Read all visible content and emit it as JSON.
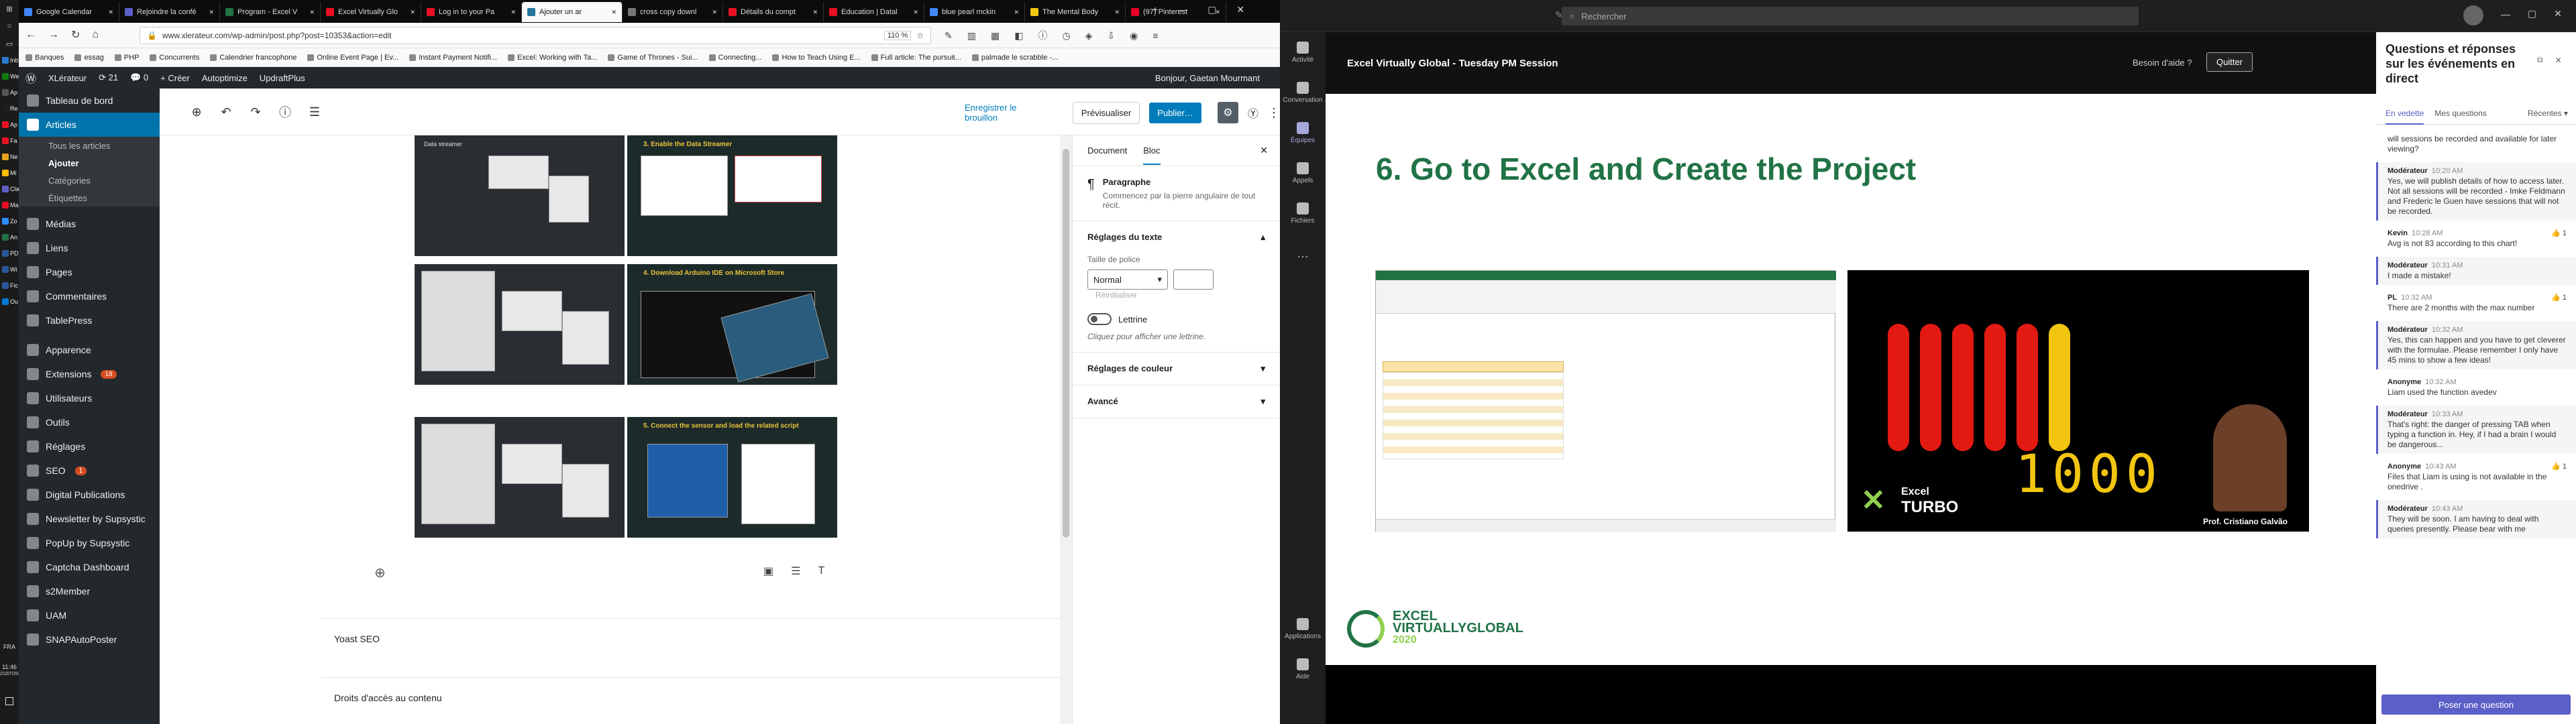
{
  "taskbar": {
    "apps": [
      {
        "label": "Inb",
        "color": "#2b7cd3"
      },
      {
        "label": "We",
        "color": "#107c10"
      },
      {
        "label": "Ap",
        "color": "#555555"
      },
      {
        "label": "Re",
        "color": "#1e1e1e"
      },
      {
        "label": "Ap",
        "color": "#e81123"
      },
      {
        "label": "Fa",
        "color": "#e81123"
      },
      {
        "label": "Ne",
        "color": "#e3a21a"
      },
      {
        "label": "Mi",
        "color": "#ffb900"
      },
      {
        "label": "Cla",
        "color": "#5b5fc7"
      },
      {
        "label": "Ma",
        "color": "#e81123"
      },
      {
        "label": "Zo",
        "color": "#2d8cff"
      },
      {
        "label": "An",
        "color": "#217346"
      },
      {
        "label": "PD",
        "color": "#2b579a"
      },
      {
        "label": "Wi",
        "color": "#2b579a"
      },
      {
        "label": "Fic",
        "color": "#2b579a"
      },
      {
        "label": "Ou",
        "color": "#0078d4"
      }
    ],
    "lang": "FRA",
    "time": "11:46",
    "date": "21/07/2020"
  },
  "firefox": {
    "tabs": [
      {
        "label": "Google Calendar",
        "color": "#4285f4"
      },
      {
        "label": "Rejoindre la confé",
        "color": "#5b5fc7"
      },
      {
        "label": "Program - Excel V",
        "color": "#217346"
      },
      {
        "label": "Excel Virtually Glo",
        "color": "#e81123"
      },
      {
        "label": "Log in to your Pa",
        "color": "#e81123"
      },
      {
        "label": "Ajouter un ar",
        "color": "#21759b",
        "active": true
      },
      {
        "label": "cross copy downl",
        "color": "#777777"
      },
      {
        "label": "Détails du compt",
        "color": "#e81123"
      },
      {
        "label": "Education | Datal",
        "color": "#e81123"
      },
      {
        "label": "blue pearl mckin",
        "color": "#4285f4"
      },
      {
        "label": "The Mental Body",
        "color": "#f2c811"
      },
      {
        "label": "(97) Pinterest",
        "color": "#e60023"
      }
    ],
    "url": "www.xlerateur.com/wp-admin/post.php?post=10353&action=edit",
    "zoom": "110 %",
    "bookmarks": [
      "Banques",
      "essag",
      "PHP",
      "Concurrents",
      "Calendrier francophone",
      "Online Event Page | Ev...",
      "Instant Payment Notifi...",
      "Excel: Working with Ta...",
      "Game of Thrones - Sui...",
      "Connecting...",
      "How to Teach Using E...",
      "Full article: The pursuit...",
      "palmade le scrabble -..."
    ]
  },
  "wpbar": {
    "site": "XLérateur",
    "updates": "21",
    "comments": "0",
    "new": "Créer",
    "autoptimize": "Autoptimize",
    "updraft": "UpdraftPlus",
    "greeting": "Bonjour, Gaetan Mourmant"
  },
  "wpmenu": {
    "dashboard": "Tableau de bord",
    "articles": "Articles",
    "sub": [
      "Tous les articles",
      "Ajouter",
      "Catégories",
      "Étiquettes"
    ],
    "items": [
      "Médias",
      "Liens",
      "Pages",
      "Commentaires",
      "TablePress",
      "Apparence",
      "Extensions",
      "Utilisateurs",
      "Outils",
      "Réglages",
      "SEO",
      "Digital Publications",
      "Newsletter by Supsystic",
      "PopUp by Supsystic",
      "Captcha Dashboard",
      "s2Member",
      "UAM",
      "SNAPAutoPoster"
    ],
    "extensions_badge": "18",
    "seo_badge": "1"
  },
  "editor": {
    "save_draft": "Enregistrer le brouillon",
    "preview": "Prévisualiser",
    "publish": "Publier…",
    "thumbs": [
      {
        "left_label": "Data streamer",
        "right_label": "3. Enable the Data Streamer"
      },
      {
        "left_label": "",
        "right_label": "4. Download Arduino IDE on Microsoft Store"
      },
      {
        "left_label": "",
        "right_label": "5. Connect the sensor and load the related script"
      }
    ],
    "panels": [
      "Yoast SEO",
      "Droits d'accès au contenu"
    ]
  },
  "inspector": {
    "tab_doc": "Document",
    "tab_block": "Bloc",
    "block_name": "Paragraphe",
    "block_desc": "Commencez par la pierre angulaire de tout récit.",
    "text_settings": "Réglages du texte",
    "font_size_label": "Taille de police",
    "font_size_value": "Normal",
    "reset": "Réinitialiser",
    "dropcap": "Lettrine",
    "dropcap_hint": "Cliquez pour afficher une lettrine.",
    "color_settings": "Réglages de couleur",
    "advanced": "Avancé"
  },
  "teams": {
    "search": "Rechercher",
    "rail": [
      "Activité",
      "Conversation",
      "Équipes",
      "Appels",
      "Fichiers",
      "…",
      "Applications",
      "Aide"
    ],
    "meeting_title": "Excel Virtually Global - Tuesday PM Session",
    "help": "Besoin d'aide ?",
    "leave": "Quitter",
    "slide_title": "6. Go to Excel and Create the Project",
    "counter": "1000",
    "logo_excel": "Excel",
    "logo_turbo": "TURBO",
    "presenter": "Prof. Cristiano Galvão",
    "footer_excel": "EXCEL",
    "footer_vg": "VIRTUALLYGLOBAL",
    "footer_year": "2020",
    "qa": {
      "title": "Questions et réponses sur les événements en direct",
      "tab_featured": "En vedette",
      "tab_mine": "Mes questions",
      "recent": "Récentes",
      "top_text": "will sessions be recorded and available for later viewing?",
      "items": [
        {
          "who": "Modérateur",
          "time": "10:20 AM",
          "text": "Yes, we will publish details of how to access later. Not all sessions will be recorded - Imke Feldmann and Frederic le Guen have sessions that will not be recorded.",
          "mod": true
        },
        {
          "who": "Kevin",
          "time": "10:28 AM",
          "text": "Avg is not 83 according to this chart!",
          "mod": false,
          "likes": "1"
        },
        {
          "who": "Modérateur",
          "time": "10:31 AM",
          "text": "I made a mistake!",
          "mod": true
        },
        {
          "who": "PL",
          "time": "10:32 AM",
          "text": "There are 2 months with the max number",
          "mod": false,
          "likes": "1"
        },
        {
          "who": "Modérateur",
          "time": "10:32 AM",
          "text": "Yes, this can happen and you have to get cleverer with the formulae. Please remember I only have 45 mins to show a few ideas!",
          "mod": true
        },
        {
          "who": "Anonyme",
          "time": "10:32 AM",
          "text": "Liam used the function avedev",
          "mod": false
        },
        {
          "who": "Modérateur",
          "time": "10:33 AM",
          "text": "That's right: the danger of pressing TAB when typing a function in. Hey, if I had a brain I would be dangerous...",
          "mod": true
        },
        {
          "who": "Anonyme",
          "time": "10:43 AM",
          "text": "Files that Liam is using is not available in the onedrive .",
          "mod": false,
          "likes": "1"
        },
        {
          "who": "Modérateur",
          "time": "10:43 AM",
          "text": "They will be soon. I am having to deal with queries presently. Please bear with me",
          "mod": true
        }
      ],
      "ask": "Poser une question"
    }
  }
}
